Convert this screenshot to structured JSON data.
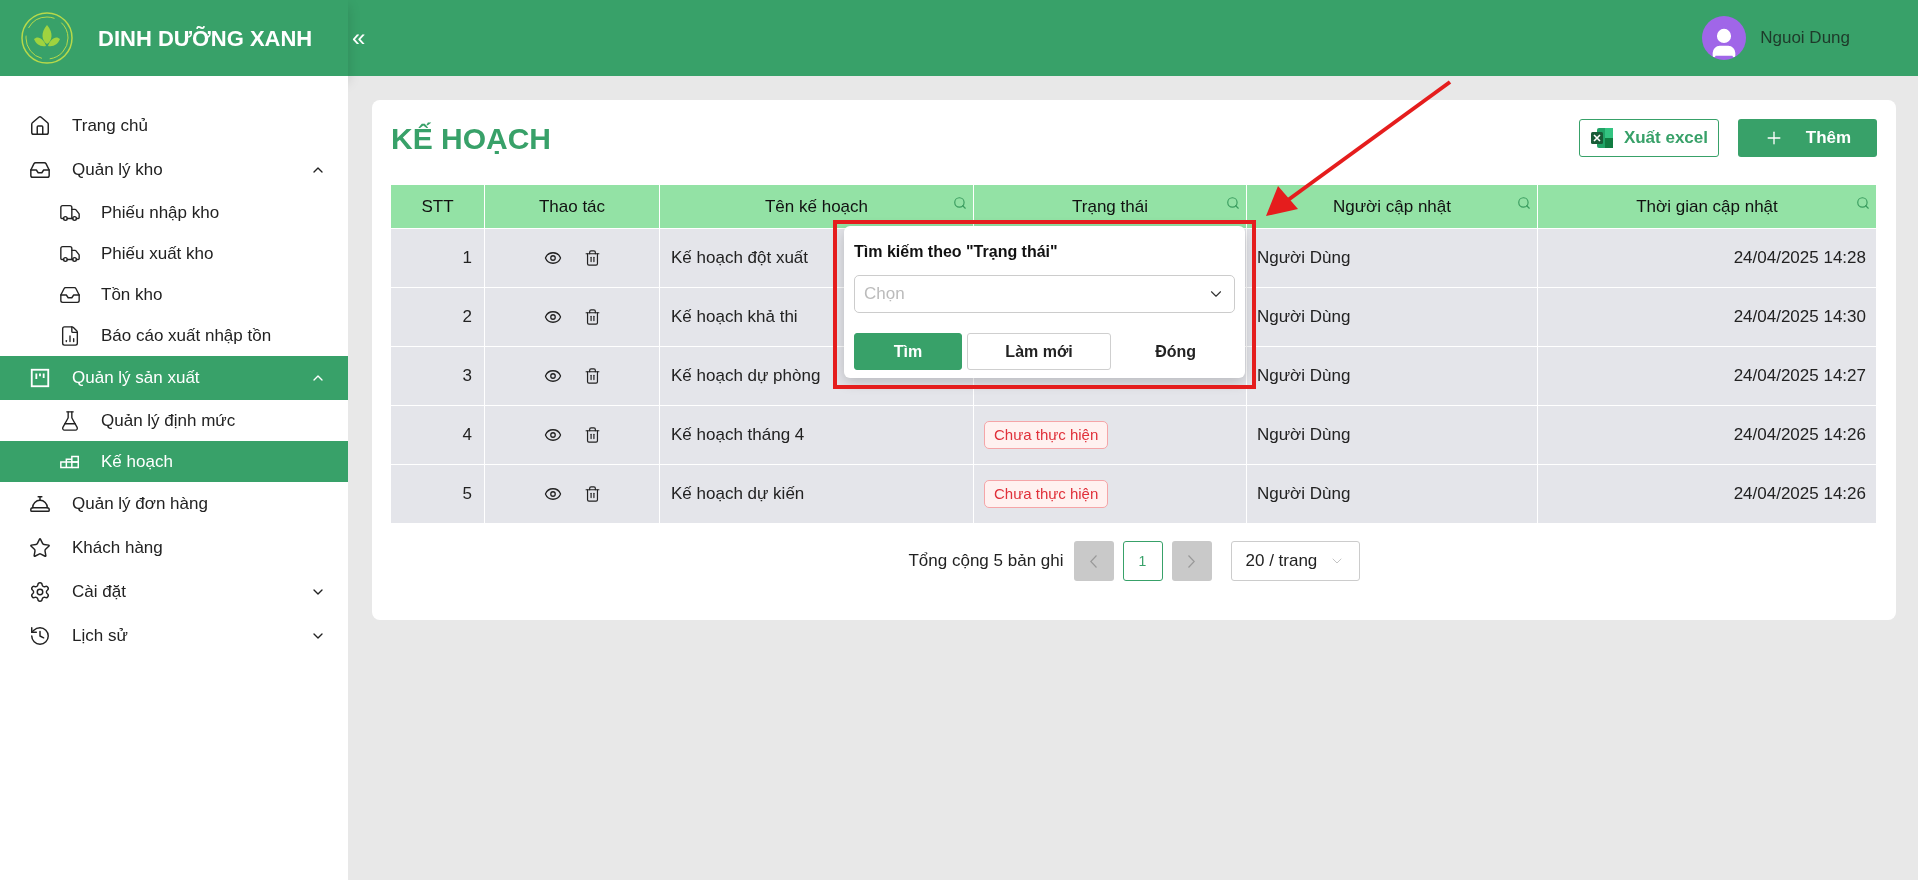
{
  "brand": {
    "title": "DINH DƯỠNG XANH",
    "collapse": "«"
  },
  "user": {
    "name": "Nguoi Dung"
  },
  "sidebar": {
    "items": [
      {
        "label": "Trang chủ",
        "selected": false
      },
      {
        "label": "Quản lý kho",
        "selected": false,
        "expanded": true,
        "children": [
          {
            "label": "Phiếu nhập kho",
            "selected": false
          },
          {
            "label": "Phiếu xuất kho",
            "selected": false
          },
          {
            "label": "Tồn kho",
            "selected": false
          },
          {
            "label": "Báo cáo xuất nhập tồn",
            "selected": false
          }
        ]
      },
      {
        "label": "Quản lý sản xuất",
        "selected": true,
        "expanded": true,
        "children": [
          {
            "label": "Quản lý định mức",
            "selected": false
          },
          {
            "label": "Kế hoạch",
            "selected": true
          }
        ]
      },
      {
        "label": "Quản lý đơn hàng",
        "selected": false
      },
      {
        "label": "Khách hàng",
        "selected": false
      },
      {
        "label": "Cài đặt",
        "selected": false,
        "expanded": false
      },
      {
        "label": "Lịch sử",
        "selected": false,
        "expanded": false
      }
    ]
  },
  "page": {
    "title": "KẾ HOẠCH",
    "actions": [
      {
        "label": "Xuất excel",
        "kind": "excel"
      },
      {
        "label": "Thêm",
        "kind": "add"
      }
    ]
  },
  "table": {
    "columns": [
      {
        "label": "STT",
        "searchable": false
      },
      {
        "label": "Thao tác",
        "searchable": false
      },
      {
        "label": "Tên kế hoạch",
        "searchable": true
      },
      {
        "label": "Trạng thái",
        "searchable": true
      },
      {
        "label": "Người cập nhật",
        "searchable": true
      },
      {
        "label": "Thời gian cập nhật",
        "searchable": true
      }
    ],
    "rows": [
      {
        "stt": "1",
        "name": "Kế hoạch đột xuất",
        "updated_by": "Người Dùng",
        "updated_at": "24/04/2025 14:28"
      },
      {
        "stt": "2",
        "name": "Kế hoạch khả thi",
        "updated_by": "Người Dùng",
        "updated_at": "24/04/2025 14:30"
      },
      {
        "stt": "3",
        "name": "Kế hoạch dự phòng",
        "updated_by": "Người Dùng",
        "updated_at": "24/04/2025 14:27"
      },
      {
        "stt": "4",
        "name": "Kế hoạch tháng 4",
        "status": {
          "label": "Chưa thực hiện",
          "kind": "pending"
        },
        "updated_by": "Người Dùng",
        "updated_at": "24/04/2025 14:26"
      },
      {
        "stt": "5",
        "name": "Kế hoạch dự kiến",
        "status": {
          "label": "Chưa thực hiện",
          "kind": "pending"
        },
        "updated_by": "Người Dùng",
        "updated_at": "24/04/2025 14:26"
      }
    ]
  },
  "filter_popup": {
    "title": "Tìm kiếm theo \"Trạng thái\"",
    "select": {
      "placeholder": "Chọn"
    },
    "buttons": [
      {
        "label": "Tìm",
        "kind": "primary"
      },
      {
        "label": "Làm mới",
        "kind": "outline"
      },
      {
        "label": "Đóng",
        "kind": "text"
      }
    ]
  },
  "pagination": {
    "summary": "Tổng cộng 5 bản ghi",
    "prev_disabled": true,
    "pages": [
      {
        "label": "1",
        "selected": true
      }
    ],
    "next_disabled": true,
    "page_size": "20 / trang"
  }
}
